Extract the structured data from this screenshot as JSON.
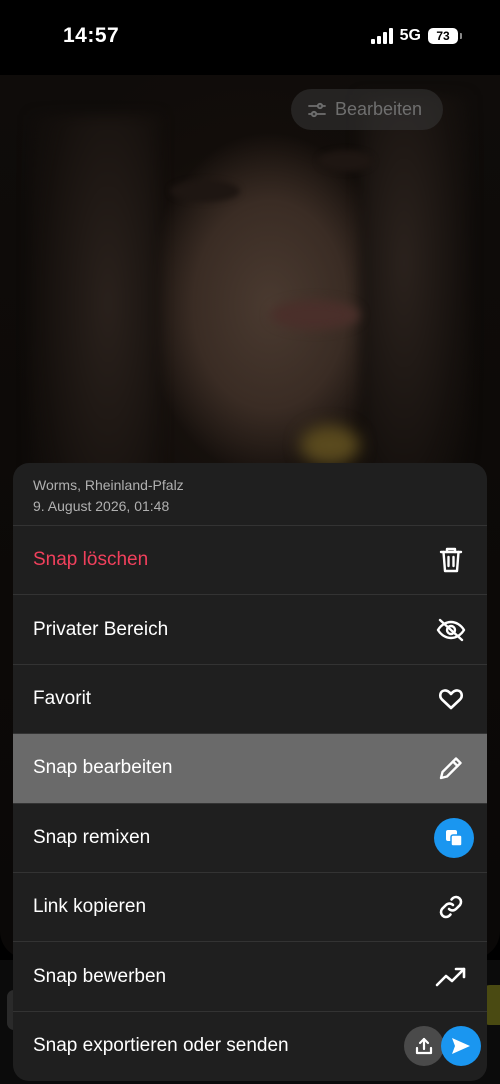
{
  "status_bar": {
    "time": "14:57",
    "network": "5G",
    "battery": "73"
  },
  "photo": {
    "edit_button_label": "Bearbeiten"
  },
  "sheet": {
    "location": "Worms, Rheinland-Pfalz",
    "date": "9. August 2026, 01:48",
    "items": [
      {
        "label": "Snap löschen",
        "icon": "trash-icon",
        "danger": true
      },
      {
        "label": "Privater Bereich",
        "icon": "eye-off-icon"
      },
      {
        "label": "Favorit",
        "icon": "heart-icon"
      },
      {
        "label": "Snap bearbeiten",
        "icon": "pencil-icon",
        "active": true
      },
      {
        "label": "Snap remixen",
        "icon": "remix-icon"
      },
      {
        "label": "Link kopieren",
        "icon": "link-icon"
      },
      {
        "label": "Snap bewerben",
        "icon": "trending-up-icon"
      },
      {
        "label": "Snap exportieren oder senden",
        "icon": "export-send-icons"
      }
    ]
  },
  "colors": {
    "danger": "#f0405c",
    "accent_blue": "#1a96f0",
    "sheet_bg": "#1f1f1f",
    "active_row": "#6a6a6a"
  }
}
